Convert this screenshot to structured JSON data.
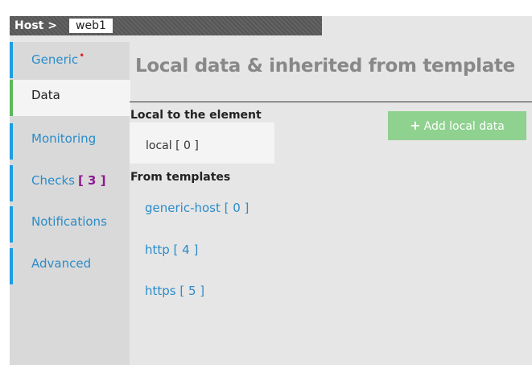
{
  "header": {
    "host_label": "Host >",
    "host_name": "web1"
  },
  "sidebar": {
    "tabs": [
      {
        "label": "Generic",
        "required_marker": "•"
      },
      {
        "label": "Data"
      },
      {
        "label": "Monitoring"
      },
      {
        "label": "Checks",
        "count": "[ 3 ]"
      },
      {
        "label": "Notifications"
      },
      {
        "label": "Advanced"
      }
    ]
  },
  "main": {
    "title": "Local data & inherited from template",
    "local_section_title": "Local to the element",
    "local_item": "local [ 0 ]",
    "add_button_label": "Add local data",
    "templates_section_title": "From templates",
    "templates": [
      "generic-host [ 0 ]",
      "http [ 4 ]",
      "https [ 5 ]"
    ]
  },
  "colors": {
    "accent": "#1e9de0",
    "active_tab_accent": "#5cb85c",
    "link": "#2c8cc9",
    "required": "#d9262c",
    "count": "#8e1a8e",
    "add_button": "#8fd18f"
  }
}
